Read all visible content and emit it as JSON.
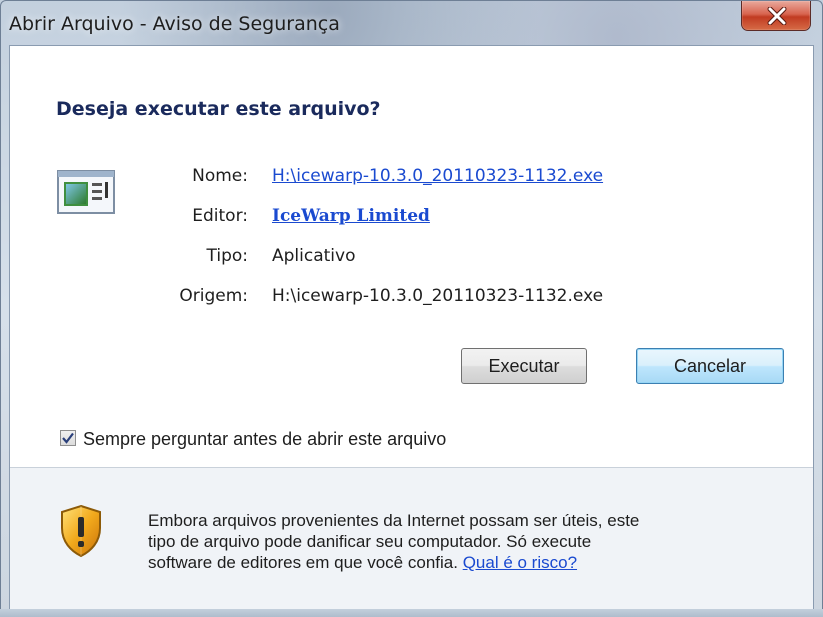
{
  "window": {
    "title": "Abrir Arquivo - Aviso de Segurança"
  },
  "dialog": {
    "heading": "Deseja executar este arquivo?",
    "fields": {
      "name_label": "Nome:",
      "name_value": "H:\\icewarp-10.3.0_20110323-1132.exe",
      "publisher_label": "Editor:",
      "publisher_value": "IceWarp Limited",
      "type_label": "Tipo:",
      "type_value": "Aplicativo",
      "from_label": "Origem:",
      "from_value": "H:\\icewarp-10.3.0_20110323-1132.exe"
    },
    "buttons": {
      "run": "Executar",
      "cancel": "Cancelar"
    },
    "checkbox": {
      "label": "Sempre perguntar antes de abrir este arquivo",
      "checked": true
    },
    "warning": {
      "line1": "Embora arquivos provenientes da Internet possam ser úteis, este",
      "line2": "tipo de arquivo pode danificar seu computador. Só execute",
      "line3_text": "software de editores em que você confia.",
      "line3_link": "Qual é o risco?"
    }
  },
  "icons": {
    "close": "close-icon",
    "file": "application-file-icon",
    "shield": "shield-warning-icon",
    "check": "checkmark-icon"
  }
}
